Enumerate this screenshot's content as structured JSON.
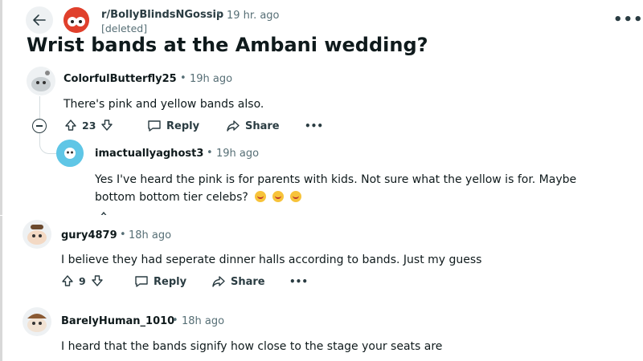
{
  "post": {
    "subreddit": "r/BollyBlindsNGossip",
    "separator": "•",
    "time": "19 hr. ago",
    "author": "[deleted]",
    "title": "Wrist bands at the Ambani wedding?",
    "more": "•••"
  },
  "comments": [
    {
      "username": "ColorfulButterfly25",
      "separator": "•",
      "time": "19h ago",
      "text": "There's pink and yellow bands also.",
      "votes": "23",
      "reply_label": "Reply",
      "share_label": "Share",
      "more": "•••"
    },
    {
      "username": "imactuallyaghost3",
      "separator": "•",
      "time": "19h ago",
      "text_line1": "Yes I've heard the pink is for parents with kids. Not sure what the yellow is for. Maybe",
      "text_line2": "bottom bottom tier celebs?"
    },
    {
      "username": "gury4879",
      "separator": "•",
      "time": "18h ago",
      "text": "I believe they had seperate dinner halls according to bands. Just my guess",
      "votes": "9",
      "reply_label": "Reply",
      "share_label": "Share",
      "more": "•••"
    },
    {
      "username": "BarelyHuman_1010",
      "separator": "•",
      "time": "18h ago",
      "text": "I heard that the bands signify how close to the stage your seats are"
    }
  ],
  "icons": [
    "back-arrow-icon",
    "upvote-icon",
    "downvote-icon",
    "reply-icon",
    "share-icon",
    "collapse-icon",
    "more-icon",
    "emoji-icon"
  ],
  "colors": {
    "subreddit_avatar": "#e0402c",
    "ghost_avatar": "#5fc6e6",
    "meta_gray": "#576f76"
  }
}
